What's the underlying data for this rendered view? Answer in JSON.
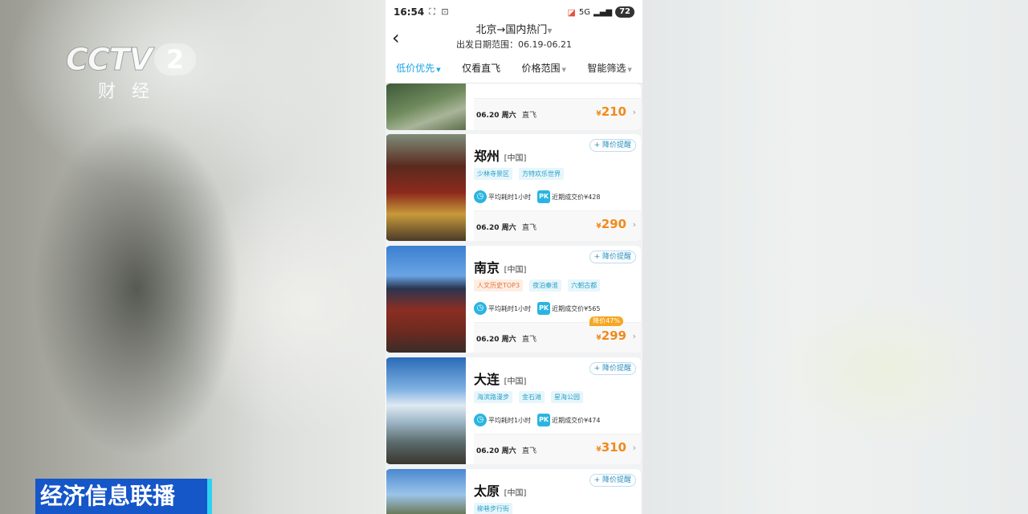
{
  "broadcast": {
    "logo_text": "CCTV",
    "logo_channel": "2",
    "logo_sub": "财经",
    "program": "经济信息联播"
  },
  "status_bar": {
    "time": "16:54",
    "battery": "72",
    "network": "5G"
  },
  "header": {
    "route": "北京→国内热门",
    "date_range": "出发日期范围：06.19-06.21"
  },
  "filters": [
    {
      "label": "低价优先",
      "active": true,
      "dropdown": true
    },
    {
      "label": "仅看直飞",
      "active": false,
      "dropdown": false
    },
    {
      "label": "价格范围",
      "active": false,
      "dropdown": true
    },
    {
      "label": "智能筛选",
      "active": false,
      "dropdown": true
    }
  ],
  "cards": [
    {
      "city": "",
      "country": "",
      "date": "06.20 周六",
      "flight": "直飞",
      "price": "210",
      "tags": [],
      "avg": "",
      "pk": ""
    },
    {
      "city": "郑州",
      "country": "[中国]",
      "alert": "+ 降价提醒",
      "tags": [
        "少林寺景区",
        "方特欢乐世界"
      ],
      "avg": "平均耗时1小时",
      "pk": "近期成交价¥428",
      "date": "06.20 周六",
      "flight": "直飞",
      "price": "290"
    },
    {
      "city": "南京",
      "country": "[中国]",
      "alert": "+ 降价提醒",
      "tags": [
        "人文历史TOP3",
        "夜泊秦淮",
        "六朝古都"
      ],
      "avg": "平均耗时1小时",
      "pk": "近期成交价¥565",
      "date": "06.20 周六",
      "flight": "直飞",
      "price": "299",
      "discount": "降价47%"
    },
    {
      "city": "大连",
      "country": "[中国]",
      "alert": "+ 降价提醒",
      "tags": [
        "海滨路漫步",
        "金石滩",
        "星海公园"
      ],
      "avg": "平均耗时1小时",
      "pk": "近期成交价¥474",
      "date": "06.20 周六",
      "flight": "直飞",
      "price": "310"
    },
    {
      "city": "太原",
      "country": "[中国]",
      "alert": "+ 降价提醒",
      "tags": [
        "柳巷步行街"
      ]
    }
  ],
  "currency": "¥",
  "colors": {
    "accent": "#1aa3e8",
    "price": "#f08a1c",
    "ticker": "#1556c9"
  }
}
